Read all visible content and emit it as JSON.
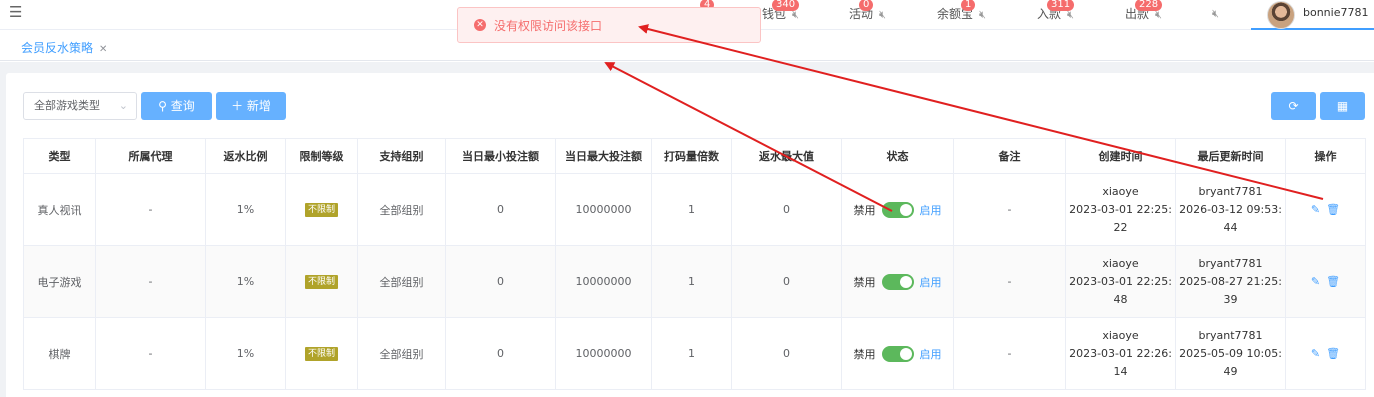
{
  "header": {
    "menu_icon": "hamburger-icon",
    "nav": [
      {
        "label": "钱包",
        "badge": "340"
      },
      {
        "label": "活动",
        "badge": "0"
      },
      {
        "label": "余额宝",
        "badge": "1"
      },
      {
        "label": "入款",
        "badge": "311"
      },
      {
        "label": "出款",
        "badge": "228"
      }
    ],
    "hidden_badge": "4",
    "user_name": "bonnie7781"
  },
  "tabs": [
    {
      "label": "会员反水策略"
    }
  ],
  "toast": {
    "message": "没有权限访问该接口",
    "color": "#f56c6c"
  },
  "toolbar": {
    "select_value": "全部游戏类型",
    "search_label": "查询",
    "add_label": "新增"
  },
  "table": {
    "headers": [
      "类型",
      "所属代理",
      "返水比例",
      "限制等级",
      "支持组别",
      "当日最小投注额",
      "当日最大投注额",
      "打码量倍数",
      "返水最大值",
      "状态",
      "备注",
      "创建时间",
      "最后更新时间",
      "操作"
    ],
    "rows": [
      {
        "type": "真人视讯",
        "agent": "-",
        "ratio": "1%",
        "level": "不限制",
        "group": "全部组别",
        "min_bet": "0",
        "max_bet": "10000000",
        "multiple": "1",
        "max_rebate": "0",
        "status_off": "禁用",
        "status_on": "启用",
        "remark": "-",
        "creator": "xiaoye",
        "created_at": "2023-03-01 22:25:",
        "created_sec": "22",
        "updater": "bryant7781",
        "updated_at": "2026-03-12 09:53:",
        "updated_sec": "44"
      },
      {
        "type": "电子游戏",
        "agent": "-",
        "ratio": "1%",
        "level": "不限制",
        "group": "全部组别",
        "min_bet": "0",
        "max_bet": "10000000",
        "multiple": "1",
        "max_rebate": "0",
        "status_off": "禁用",
        "status_on": "启用",
        "remark": "-",
        "creator": "xiaoye",
        "created_at": "2023-03-01 22:25:",
        "created_sec": "48",
        "updater": "bryant7781",
        "updated_at": "2025-08-27 21:25:",
        "updated_sec": "39"
      },
      {
        "type": "棋牌",
        "agent": "-",
        "ratio": "1%",
        "level": "不限制",
        "group": "全部组别",
        "min_bet": "0",
        "max_bet": "10000000",
        "multiple": "1",
        "max_rebate": "0",
        "status_off": "禁用",
        "status_on": "启用",
        "remark": "-",
        "creator": "xiaoye",
        "created_at": "2023-03-01 22:26:",
        "created_sec": "14",
        "updater": "bryant7781",
        "updated_at": "2025-05-09 10:05:",
        "updated_sec": "49"
      }
    ]
  },
  "colors": {
    "accent": "#409eff",
    "button": "#66b1ff",
    "switch_on": "#5cb85c",
    "tag": "#b0a32a",
    "badge": "#f56c6c",
    "annotation": "#e02020"
  }
}
